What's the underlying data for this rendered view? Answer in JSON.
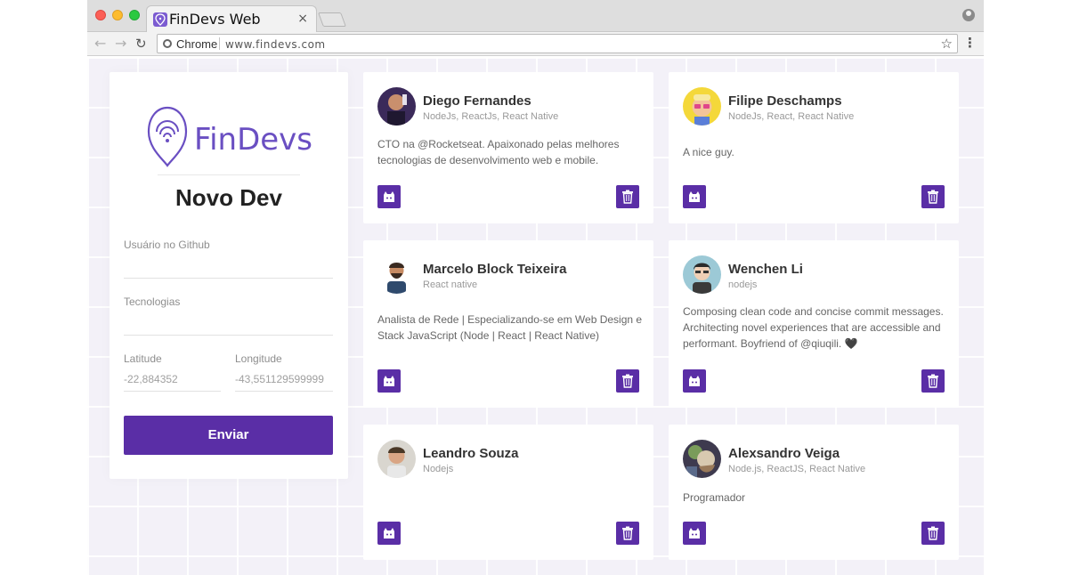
{
  "browser": {
    "tab_title": "FinDevs Web",
    "tab_close": "×",
    "chrome_label": "Chrome",
    "url": "www.findevs.com"
  },
  "form": {
    "logo_text": "FinDevs",
    "title": "Novo Dev",
    "github_label": "Usuário no Github",
    "techs_label": "Tecnologias",
    "latitude_label": "Latitude",
    "latitude_value": "-22,884352",
    "longitude_label": "Longitude",
    "longitude_value": "-43,551129599999",
    "submit_label": "Enviar"
  },
  "devs": [
    {
      "name": "Diego Fernandes",
      "techs": "NodeJs, ReactJs, React Native",
      "bio": "CTO na @Rocketseat. Apaixonado pelas melhores tecnologias de desenvolvimento web e mobile."
    },
    {
      "name": "Filipe Deschamps",
      "techs": "NodeJs, React, React Native",
      "bio": "A nice guy."
    },
    {
      "name": "Marcelo Block Teixeira",
      "techs": "React native",
      "bio": "Analista de Rede | Especializando-se em Web Design e Stack JavaScript (Node | React | React Native)"
    },
    {
      "name": "Wenchen Li",
      "techs": "nodejs",
      "bio": "Composing clean code and concise commit messages. Architecting novel experiences that are accessible and performant. Boyfriend of @qiuqili. 🖤"
    },
    {
      "name": "Leandro Souza",
      "techs": "Nodejs",
      "bio": ""
    },
    {
      "name": "Alexsandro Veiga",
      "techs": "Node.js, ReactJS, React Native",
      "bio": "Programador"
    }
  ],
  "colors": {
    "brand": "#5a2ea6",
    "background": "#f3f1f8"
  }
}
